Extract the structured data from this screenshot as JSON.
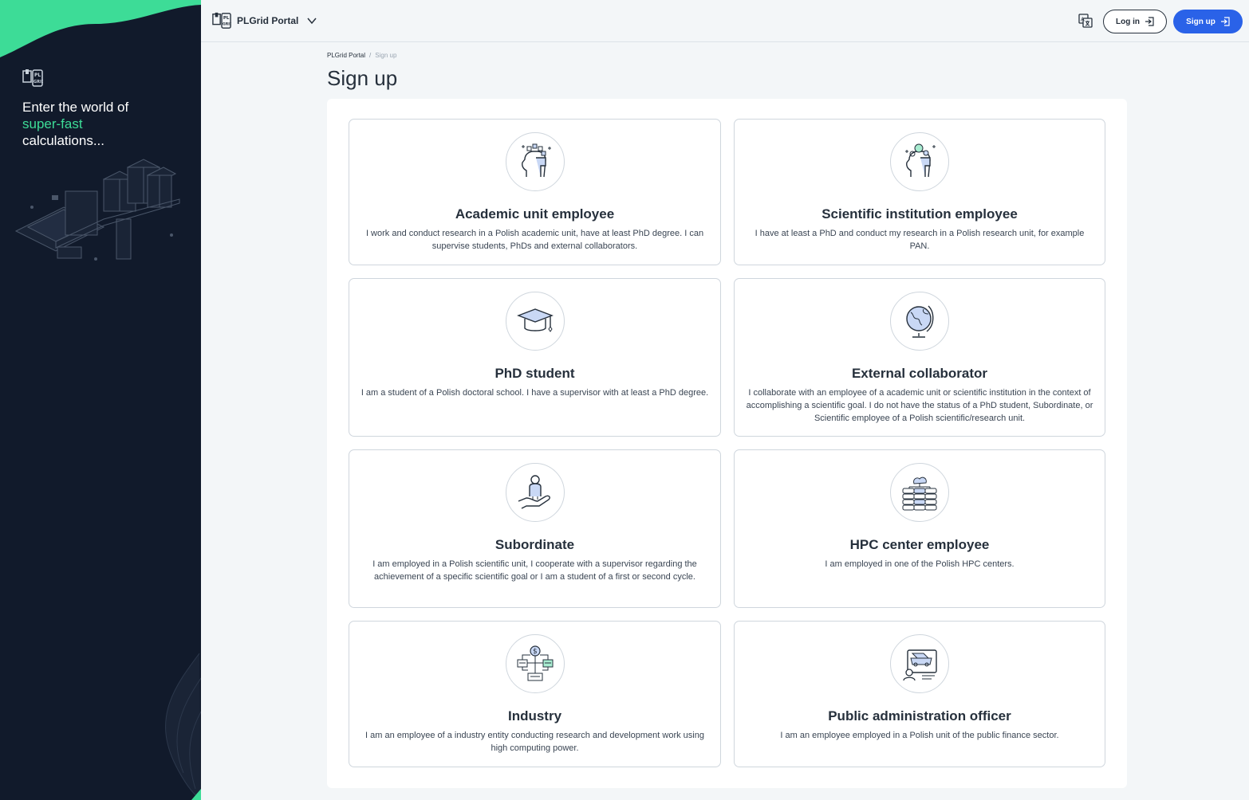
{
  "sidebar": {
    "tagline_1": "Enter the world of",
    "tagline_2": "super-fast",
    "tagline_3": "calculations..."
  },
  "header": {
    "brand": "PLGrid Portal",
    "login_label": "Log in",
    "signup_label": "Sign up"
  },
  "breadcrumb": {
    "home": "PLGrid Portal",
    "separator": "/",
    "current": "Sign up"
  },
  "page": {
    "title": "Sign up"
  },
  "cards": [
    {
      "title": "Academic unit employee",
      "desc": "I work and conduct research in a Polish academic unit, have at least PhD degree. I can supervise students, PhDs and external collaborators.",
      "icon": "academic-head-icon"
    },
    {
      "title": "Scientific institution employee",
      "desc": "I have at least a PhD and conduct my research in a Polish research unit, for example PAN.",
      "icon": "scientist-head-icon"
    },
    {
      "title": "PhD student",
      "desc": "I am a student of a Polish doctoral school. I have a supervisor with at least a PhD degree.",
      "icon": "graduation-cap-icon"
    },
    {
      "title": "External collaborator",
      "desc": "I collaborate with an employee of a academic unit or scientific institution in the context of accomplishing a scientific goal. I do not have the status of a PhD student, Subordinate, or Scientific employee of a Polish scientific/research unit.",
      "icon": "globe-icon"
    },
    {
      "title": "Subordinate",
      "desc": "I am employed in a Polish scientific unit, I cooperate with a supervisor regarding the achievement of a specific scientific goal or I am a student of a first or second cycle.",
      "icon": "person-hand-icon"
    },
    {
      "title": "HPC center employee",
      "desc": "I am employed in one of the Polish HPC centers.",
      "icon": "server-cloud-icon"
    },
    {
      "title": "Industry",
      "desc": "I am an employee of a industry entity conducting research and development work using high computing power.",
      "icon": "industry-network-icon"
    },
    {
      "title": "Public administration officer",
      "desc": "I am an employee employed in a Polish unit of the public finance sector.",
      "icon": "officer-computer-icon"
    }
  ],
  "colors": {
    "sidebar_bg": "#111a2b",
    "accent_green": "#3ddc97",
    "primary_blue": "#2a62e8"
  }
}
